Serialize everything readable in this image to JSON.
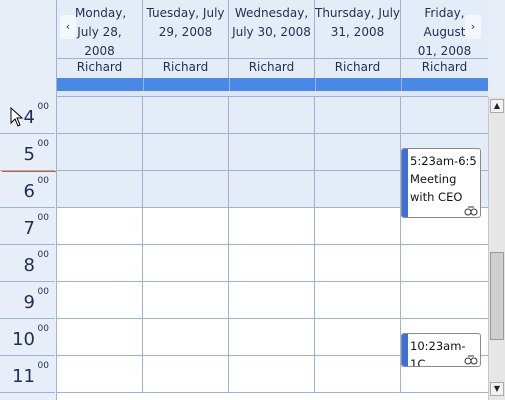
{
  "navigation": {
    "prev_label": "‹",
    "next_label": "›"
  },
  "days": [
    {
      "date": "Monday, July 28, 2008",
      "owner": "Richard"
    },
    {
      "date": "Tuesday, July 29, 2008",
      "owner": "Richard"
    },
    {
      "date": "Wednesday, July 30, 2008",
      "owner": "Richard"
    },
    {
      "date": "Thursday, July 31, 2008",
      "owner": "Richard"
    },
    {
      "date": "Friday, August 01, 2008",
      "owner": "Richard"
    }
  ],
  "hours": [
    {
      "hour": "4",
      "minutes": "00"
    },
    {
      "hour": "5",
      "minutes": "00"
    },
    {
      "hour": "6",
      "minutes": "00"
    },
    {
      "hour": "7",
      "minutes": "00"
    },
    {
      "hour": "8",
      "minutes": "00"
    },
    {
      "hour": "9",
      "minutes": "00"
    },
    {
      "hour": "10",
      "minutes": "00"
    },
    {
      "hour": "11",
      "minutes": "00"
    }
  ],
  "appointments": [
    {
      "text": "5:23am-6:5 Meeting with CEO",
      "color": "#3d6fd6"
    },
    {
      "text": "10:23am-1C",
      "color": "#3d6fd6"
    }
  ],
  "colors": {
    "accent": "#4a88e6",
    "nonworking": "#e4ecf8",
    "gridline": "#9ab3d6",
    "now_indicator": "#d06010"
  },
  "scrollbar": {
    "up_icon": "▲",
    "down_icon": "▼"
  }
}
